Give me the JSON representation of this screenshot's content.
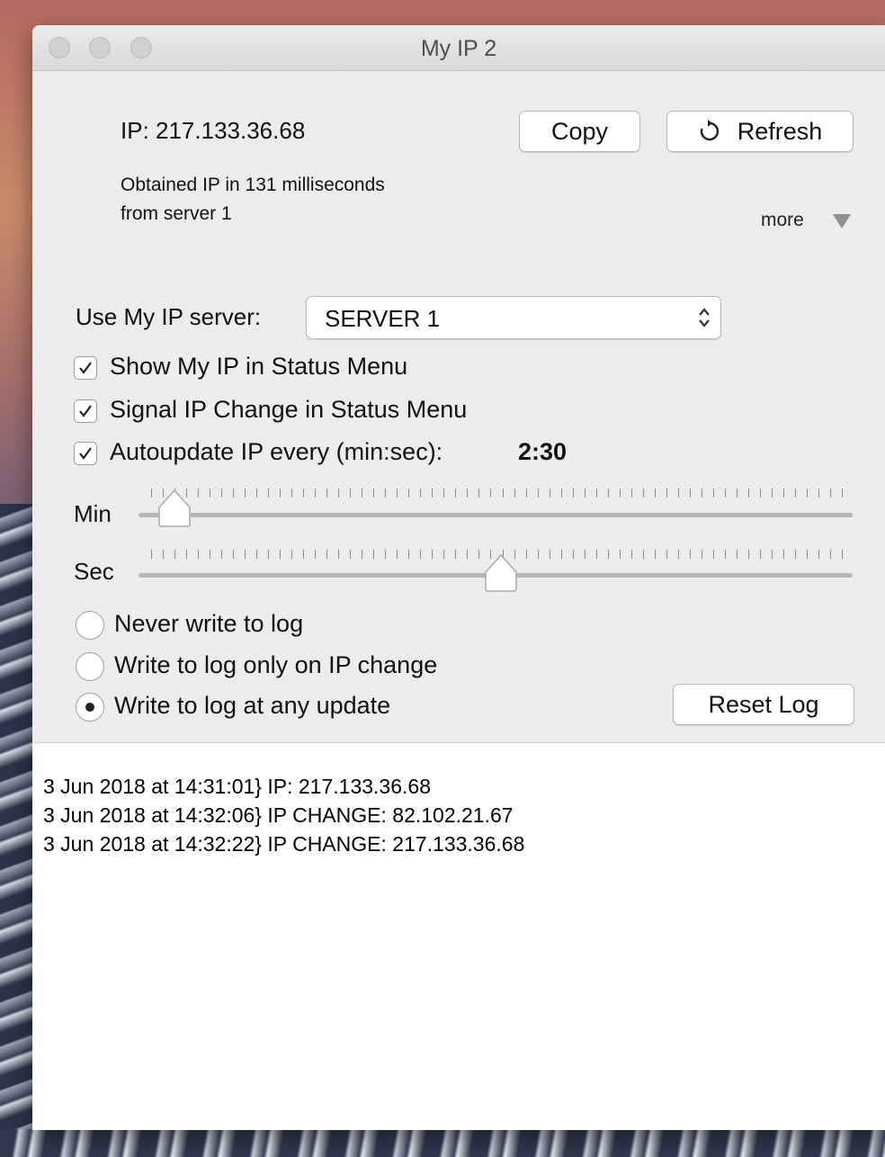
{
  "window": {
    "title": "My IP 2"
  },
  "status": {
    "ip_text": "IP: 217.133.36.68",
    "obtained_line1": "Obtained IP in 131 milliseconds",
    "obtained_line2": "from server 1"
  },
  "toolbar": {
    "copy_label": "Copy",
    "refresh_label": "Refresh",
    "more_label": "more",
    "icons": {
      "refresh": "refresh-icon",
      "more": "disclosure-triangle-icon"
    }
  },
  "server": {
    "label": "Use My IP server:",
    "selected": "SERVER 1"
  },
  "options": {
    "show_in_status_menu": {
      "label": "Show My IP in Status Menu",
      "checked": true
    },
    "signal_ip_change": {
      "label": "Signal IP Change in Status Menu",
      "checked": true
    },
    "autoupdate": {
      "label": "Autoupdate IP every (min:sec):",
      "checked": true,
      "interval": "2:30"
    }
  },
  "sliders": {
    "min": {
      "label": "Min",
      "value": 2
    },
    "sec": {
      "label": "Sec",
      "value": 30
    }
  },
  "log_mode": {
    "options": [
      {
        "label": "Never write to log",
        "selected": false
      },
      {
        "label": "Write to log only on IP change",
        "selected": false
      },
      {
        "label": "Write to log at any update",
        "selected": true
      }
    ],
    "reset_label": "Reset Log"
  },
  "log": {
    "lines": [
      "3 Jun 2018 at 14:31:01} IP: 217.133.36.68",
      "3 Jun 2018 at 14:32:06} IP CHANGE: 82.102.21.67",
      "3 Jun 2018 at 14:32:22} IP CHANGE: 217.133.36.68"
    ]
  }
}
